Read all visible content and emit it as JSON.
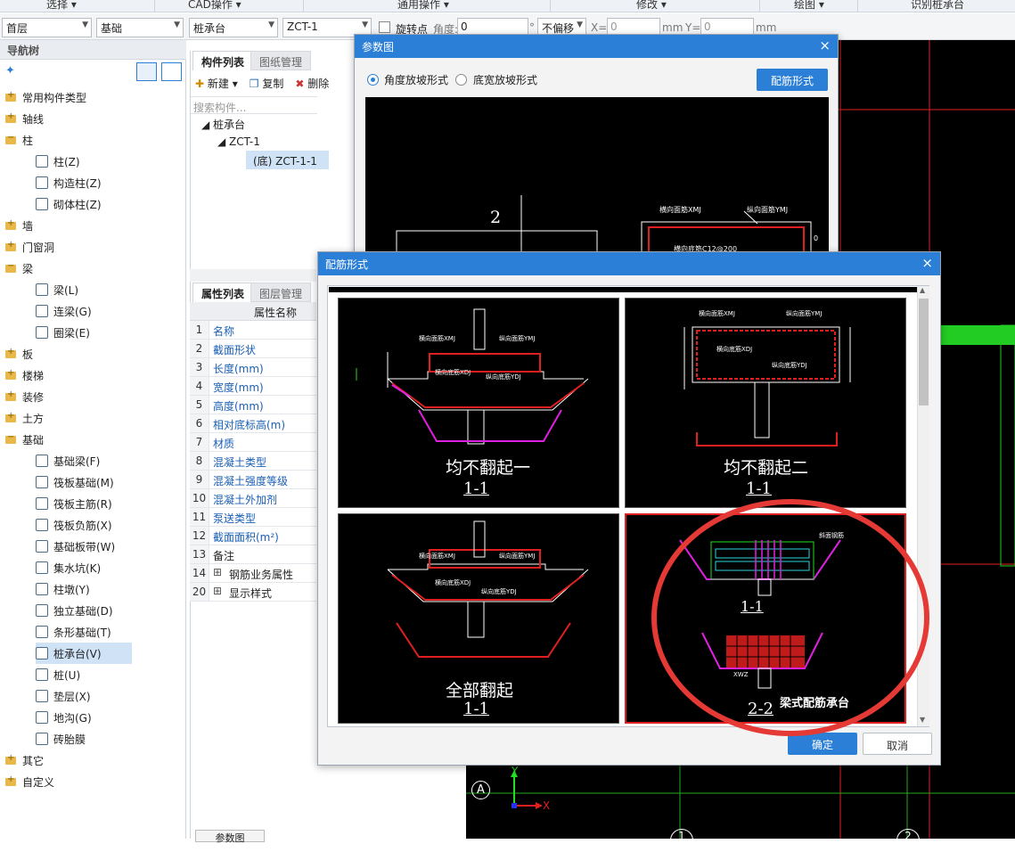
{
  "ribbon": {
    "items": [
      "选择 ▾",
      "CAD操作 ▾",
      "通用操作 ▾",
      "修改 ▾",
      "绘图 ▾",
      "识别桩承台"
    ]
  },
  "toolbar": {
    "floor": "首层",
    "category": "基础",
    "type": "桩承台",
    "component": "ZCT-1",
    "rotate_label": "旋转点",
    "angle_label": "角度:",
    "angle_value": "0",
    "degree_sign": "°",
    "offset_value": "不偏移",
    "x_label": "X=",
    "x_value": "0",
    "mm1": "mm",
    "y_label": "Y=",
    "y_value": "0",
    "mm2": "mm"
  },
  "nav": {
    "title": "导航树",
    "items": [
      {
        "label": "常用构件类型",
        "type": "folder"
      },
      {
        "label": "轴线",
        "type": "folder"
      },
      {
        "label": "柱",
        "type": "folder-open"
      },
      {
        "label": "柱(Z)",
        "type": "child"
      },
      {
        "label": "构造柱(Z)",
        "type": "child"
      },
      {
        "label": "砌体柱(Z)",
        "type": "child"
      },
      {
        "label": "墙",
        "type": "folder"
      },
      {
        "label": "门窗洞",
        "type": "folder"
      },
      {
        "label": "梁",
        "type": "folder-open"
      },
      {
        "label": "梁(L)",
        "type": "child"
      },
      {
        "label": "连梁(G)",
        "type": "child"
      },
      {
        "label": "圈梁(E)",
        "type": "child"
      },
      {
        "label": "板",
        "type": "folder"
      },
      {
        "label": "楼梯",
        "type": "folder"
      },
      {
        "label": "装修",
        "type": "folder"
      },
      {
        "label": "土方",
        "type": "folder"
      },
      {
        "label": "基础",
        "type": "folder-open"
      },
      {
        "label": "基础梁(F)",
        "type": "child"
      },
      {
        "label": "筏板基础(M)",
        "type": "child"
      },
      {
        "label": "筏板主筋(R)",
        "type": "child"
      },
      {
        "label": "筏板负筋(X)",
        "type": "child"
      },
      {
        "label": "基础板带(W)",
        "type": "child"
      },
      {
        "label": "集水坑(K)",
        "type": "child"
      },
      {
        "label": "柱墩(Y)",
        "type": "child"
      },
      {
        "label": "独立基础(D)",
        "type": "child"
      },
      {
        "label": "条形基础(T)",
        "type": "child"
      },
      {
        "label": "桩承台(V)",
        "type": "child-selected"
      },
      {
        "label": "桩(U)",
        "type": "child"
      },
      {
        "label": "垫层(X)",
        "type": "child"
      },
      {
        "label": "地沟(G)",
        "type": "child"
      },
      {
        "label": "砖胎膜",
        "type": "child"
      },
      {
        "label": "其它",
        "type": "folder"
      },
      {
        "label": "自定义",
        "type": "folder"
      }
    ]
  },
  "components": {
    "tab_active": "构件列表",
    "tab_inactive": "图纸管理",
    "new_label": "新建 ▾",
    "copy_label": "复制",
    "delete_label": "删除",
    "search_placeholder": "搜索构件...",
    "tree": [
      "桩承台",
      "ZCT-1",
      "(底) ZCT-1-1"
    ]
  },
  "properties": {
    "tab_active": "属性列表",
    "tab_inactive": "图层管理",
    "header": "属性名称",
    "rows": [
      {
        "idx": "1",
        "name": "名称"
      },
      {
        "idx": "2",
        "name": "截面形状"
      },
      {
        "idx": "3",
        "name": "长度(mm)"
      },
      {
        "idx": "4",
        "name": "宽度(mm)"
      },
      {
        "idx": "5",
        "name": "高度(mm)"
      },
      {
        "idx": "6",
        "name": "相对底标高(m)"
      },
      {
        "idx": "7",
        "name": "材质"
      },
      {
        "idx": "8",
        "name": "混凝土类型"
      },
      {
        "idx": "9",
        "name": "混凝土强度等级"
      },
      {
        "idx": "10",
        "name": "混凝土外加剂"
      },
      {
        "idx": "11",
        "name": "泵送类型"
      },
      {
        "idx": "12",
        "name": "截面面积(m²)"
      },
      {
        "idx": "13",
        "name": "备注"
      },
      {
        "idx": "14",
        "name": "钢筋业务属性"
      },
      {
        "idx": "20",
        "name": "显示样式"
      }
    ],
    "bottom_tab": "参数图"
  },
  "param_dialog": {
    "title": "参数图",
    "radio1": "角度放坡形式",
    "radio2": "底宽放坡形式",
    "button": "配筋形式",
    "drawing_num": "2",
    "lbl_tx": "横向面筋XMJ",
    "lbl_zx": "纵向面筋YMJ",
    "lbl_bottom": "横向底筋C12@200",
    "lbl_right": "0"
  },
  "rebar_dialog": {
    "title": "配筋形式",
    "options": [
      {
        "caption": "均不翻起一",
        "sub": "1-1"
      },
      {
        "caption": "均不翻起二",
        "sub": "1-1"
      },
      {
        "caption": "全部翻起",
        "sub": "1-1"
      },
      {
        "caption": "梁式配筋承台",
        "sub": "2-2",
        "sub_top": "1-1"
      }
    ],
    "ok": "确定",
    "cancel": "取消",
    "lbl_xmj": "横向面筋XMJ",
    "lbl_ymj": "纵向面筋YMJ",
    "lbl_xdj": "横向底筋XDJ",
    "lbl_ydj": "纵向底筋YDJ",
    "lbl_slope": "斜面钢筋",
    "lbl_xwz": "XWZ"
  },
  "cad": {
    "axis_y": "Y",
    "axis_x": "X",
    "bubble": "A",
    "grid1": "1",
    "grid2": "2"
  },
  "colors": {
    "accent": "#2c7fd6",
    "highlight": "#e53935"
  }
}
